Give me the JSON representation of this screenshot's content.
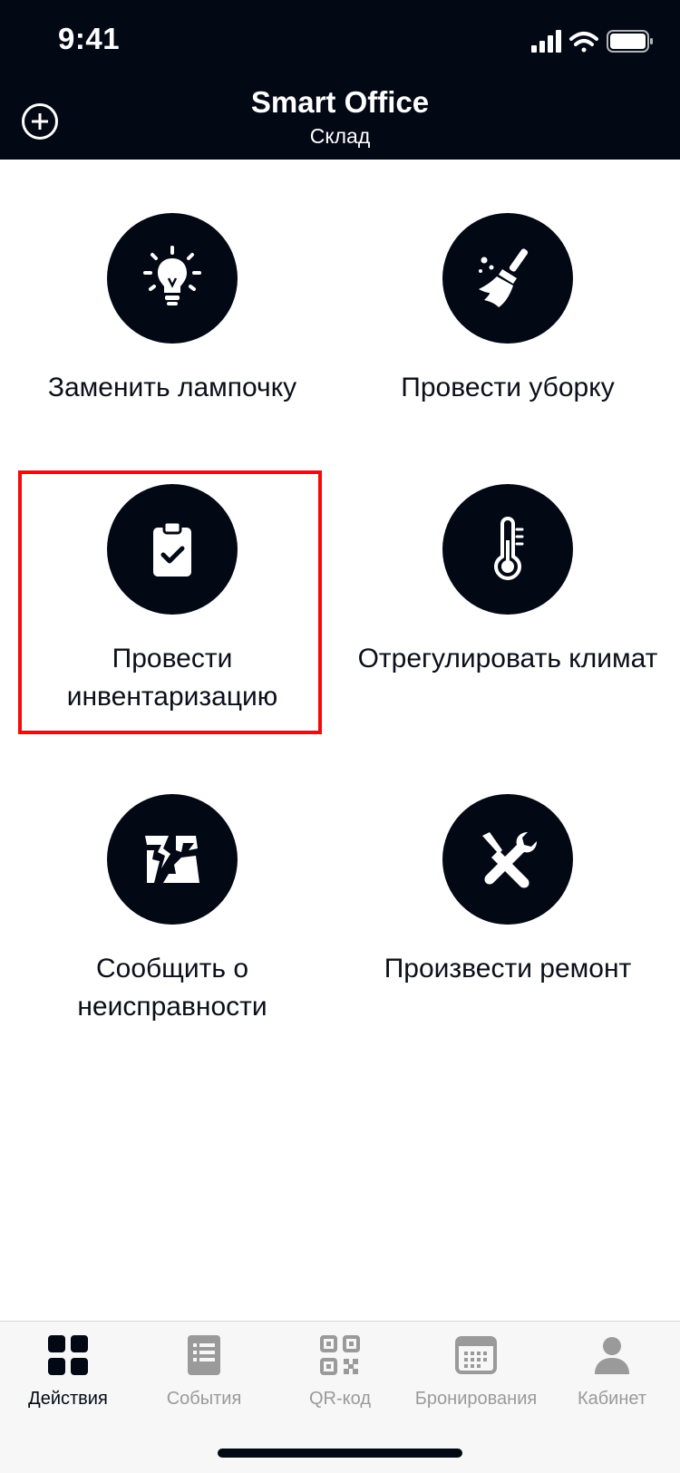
{
  "status_bar": {
    "time": "9:41"
  },
  "header": {
    "title": "Smart Office",
    "subtitle": "Склад"
  },
  "actions": [
    {
      "label": "Заменить лампочку",
      "icon": "lightbulb-icon"
    },
    {
      "label": "Провести уборку",
      "icon": "broom-icon"
    },
    {
      "label": "Провести инвентаризацию",
      "icon": "clipboard-check-icon"
    },
    {
      "label": "Отрегулировать климат",
      "icon": "thermometer-icon"
    },
    {
      "label": "Сообщить о неисправности",
      "icon": "broken-icon"
    },
    {
      "label": "Произвести ремонт",
      "icon": "tools-icon"
    }
  ],
  "tabs": [
    {
      "label": "Действия",
      "icon": "grid-icon",
      "active": true
    },
    {
      "label": "События",
      "icon": "list-icon",
      "active": false
    },
    {
      "label": "QR-код",
      "icon": "qr-code-icon",
      "active": false
    },
    {
      "label": "Бронирования",
      "icon": "calendar-icon",
      "active": false
    },
    {
      "label": "Кабинет",
      "icon": "person-icon",
      "active": false
    }
  ],
  "colors": {
    "header_bg": "#030815",
    "highlight": "#f40a0a",
    "inactive_tab": "#9a9a9a"
  }
}
